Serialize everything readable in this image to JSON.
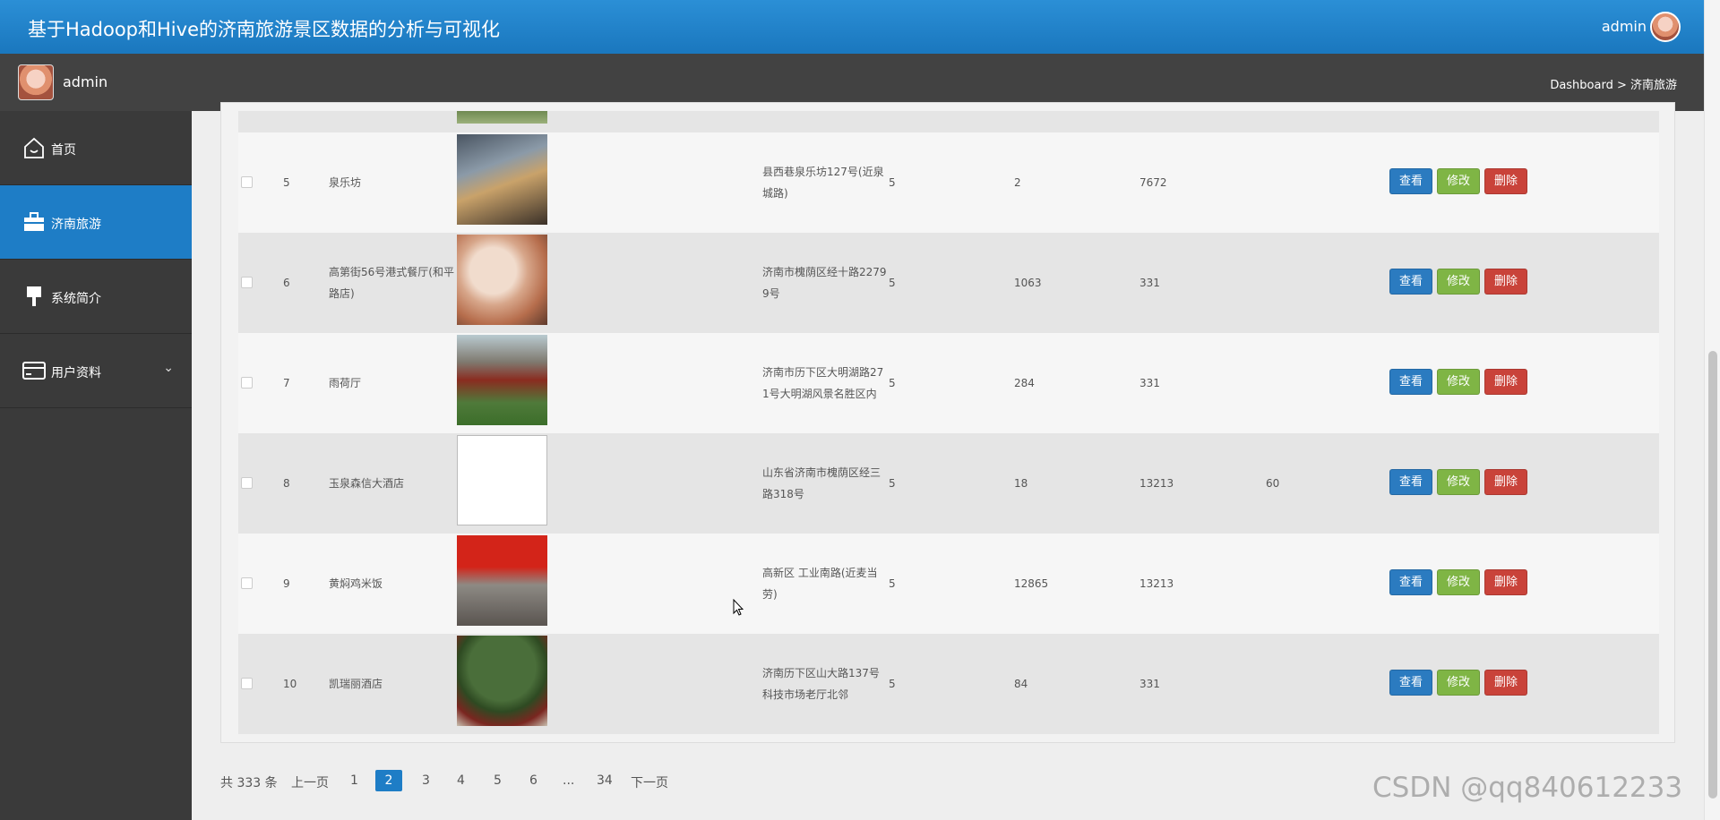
{
  "header": {
    "title": "基于Hadoop和Hive的济南旅游景区数据的分析与可视化",
    "user": "admin"
  },
  "subbar": {
    "name": "admin",
    "breadcrumb": "Dashboard > 济南旅游"
  },
  "sidebar": {
    "items": [
      {
        "label": "首页",
        "icon": "home-icon"
      },
      {
        "label": "济南旅游",
        "icon": "briefcase-icon",
        "active": true
      },
      {
        "label": "系统简介",
        "icon": "brush-icon"
      },
      {
        "label": "用户资料",
        "icon": "card-icon",
        "has_chevron": true
      }
    ]
  },
  "rows": [
    {
      "no": "5",
      "name": "泉乐坊",
      "addr1": "县西巷泉乐坊127号(近泉",
      "addr2": "城路)",
      "rating": "5",
      "c1": "2",
      "c2": "7672",
      "c3": ""
    },
    {
      "no": "6",
      "name": "高第街56号港式餐厅(和平",
      "name2": "路店)",
      "addr1": "济南市槐荫区经十路2279",
      "addr2": "9号",
      "rating": "5",
      "c1": "1063",
      "c2": "331",
      "c3": ""
    },
    {
      "no": "7",
      "name": "雨荷厅",
      "addr1": "济南市历下区大明湖路27",
      "addr2": "1号大明湖风景名胜区内",
      "rating": "5",
      "c1": "284",
      "c2": "331",
      "c3": ""
    },
    {
      "no": "8",
      "name": "玉泉森信大酒店",
      "addr1": "山东省济南市槐荫区经三",
      "addr2": "路318号",
      "rating": "5",
      "c1": "18",
      "c2": "13213",
      "c3": "60"
    },
    {
      "no": "9",
      "name": "黄焖鸡米饭",
      "addr1": "高新区 工业南路(近麦当",
      "addr2": "劳)",
      "rating": "5",
      "c1": "12865",
      "c2": "13213",
      "c3": ""
    },
    {
      "no": "10",
      "name": "凯瑞丽酒店",
      "addr1": "济南历下区山大路137号",
      "addr2": "科技市场老厅北邻",
      "rating": "5",
      "c1": "84",
      "c2": "331",
      "c3": ""
    }
  ],
  "actions": {
    "view": "查看",
    "edit": "修改",
    "delete": "删除"
  },
  "pagination": {
    "total": "共 333 条",
    "prev": "上一页",
    "pages": [
      "1",
      "2",
      "3",
      "4",
      "5",
      "6",
      "...",
      "34"
    ],
    "current": "2",
    "next": "下一页"
  },
  "watermark": "CSDN @qq840612233"
}
